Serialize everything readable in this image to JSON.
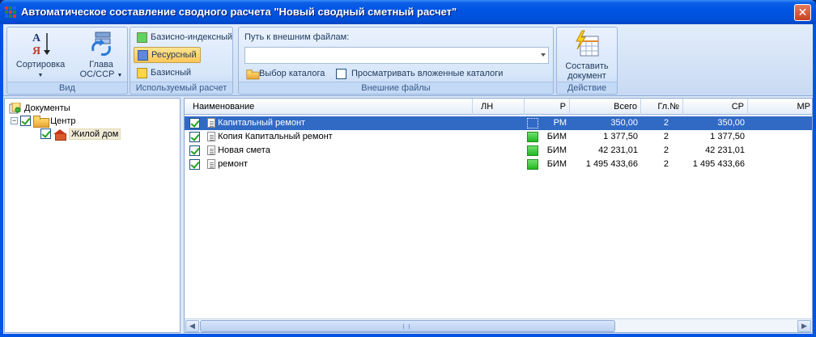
{
  "window": {
    "title": "Автоматическое составление сводного расчета \"Новый сводный сметный расчет\"",
    "close_glyph": "✕",
    "icon_colors": [
      "#e03a2a",
      "#2a8a2a",
      "#2a5ee0",
      "#2a8a2a",
      "#e03a2a",
      "#2a8a2a",
      "#2a5ee0",
      "#2a8a2a",
      "#e03a2a"
    ]
  },
  "ribbon": {
    "view": {
      "label": "Вид",
      "sort_label": "Сортировка",
      "chapter_label_1": "Глава",
      "chapter_label_2": "ОС/ССР"
    },
    "calc": {
      "label": "Используемый расчет",
      "options": [
        {
          "label": "Базисно-индексный",
          "color": "#5fd45f",
          "active": false
        },
        {
          "label": "Ресурсный",
          "color": "#5f86e0",
          "active": true
        },
        {
          "label": "Базисный",
          "color": "#ffd34a",
          "active": false
        }
      ]
    },
    "external": {
      "label": "Внешние файлы",
      "path_label": "Путь к внешним файлам:",
      "path_value": "",
      "choose_dir": "Выбор каталога",
      "browse_nested": "Просматривать вложенные каталоги",
      "browse_nested_checked": false
    },
    "action": {
      "label": "Действие",
      "compose_1": "Составить",
      "compose_2": "документ"
    }
  },
  "tree": {
    "root": "Документы",
    "center": "Центр",
    "house": "Жилой дом"
  },
  "grid": {
    "columns": [
      "Наименование",
      "ЛН",
      "Р",
      "Всего",
      "Гл.№",
      "СР",
      "МР"
    ],
    "rows": [
      {
        "name": "Капитальный ремонт",
        "r": "РМ",
        "total": "350,00",
        "chapter": "2",
        "sr": "350,00",
        "selected": true
      },
      {
        "name": "Копия Капитальный ремонт",
        "r": "БИМ",
        "total": "1 377,50",
        "chapter": "2",
        "sr": "1 377,50",
        "selected": false
      },
      {
        "name": "Новая смета",
        "r": "БИМ",
        "total": "42 231,01",
        "chapter": "2",
        "sr": "42 231,01",
        "selected": false
      },
      {
        "name": "ремонт",
        "r": "БИМ",
        "total": "1 495 433,66",
        "chapter": "2",
        "sr": "1 495 433,66",
        "selected": false
      }
    ]
  }
}
